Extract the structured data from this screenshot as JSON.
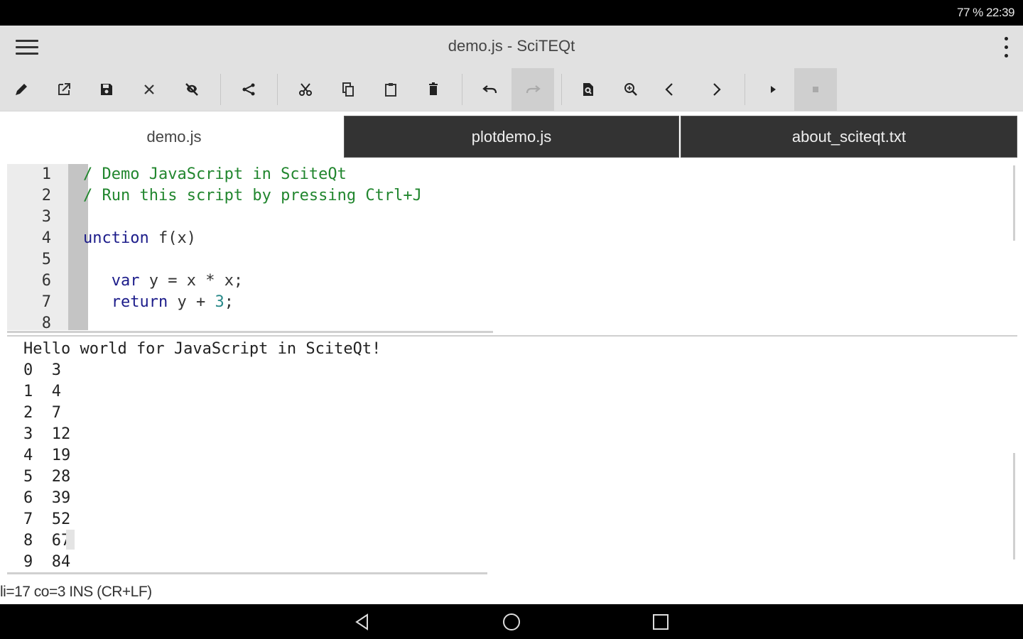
{
  "status_bar": {
    "text": "77 %   22:39"
  },
  "app": {
    "title": "demo.js - SciTEQt"
  },
  "tabs": [
    {
      "label": "demo.js",
      "active": true
    },
    {
      "label": "plotdemo.js",
      "active": false
    },
    {
      "label": "about_sciteqt.txt",
      "active": false
    }
  ],
  "editor": {
    "line_numbers": [
      "1",
      "2",
      "3",
      "4",
      "5",
      "6",
      "7",
      "8"
    ],
    "lines": [
      [
        {
          "t": "/ Demo JavaScript in SciteQt",
          "k": "comment"
        }
      ],
      [
        {
          "t": "/ Run this script by pressing Ctrl+J",
          "k": "comment"
        }
      ],
      [],
      [
        {
          "t": "unction",
          "k": "keyword"
        },
        {
          "t": " f(x)",
          "k": "plain"
        }
      ],
      [],
      [
        {
          "t": "   var",
          "k": "keyword"
        },
        {
          "t": " y = x * x;",
          "k": "plain"
        }
      ],
      [
        {
          "t": "   return",
          "k": "keyword"
        },
        {
          "t": " y + ",
          "k": "plain"
        },
        {
          "t": "3",
          "k": "number"
        },
        {
          "t": ";",
          "k": "plain"
        }
      ],
      []
    ]
  },
  "output": {
    "lines": [
      "Hello world for JavaScript in SciteQt!",
      "0  3",
      "1  4",
      "2  7",
      "3  12",
      "4  19",
      "5  28",
      "6  39",
      "7  52",
      "8  67",
      "9  84"
    ]
  },
  "editor_status": "li=17 co=3 INS (CR+LF)",
  "toolbar": {
    "icons": [
      "edit-icon",
      "open-external-icon",
      "save-icon",
      "close-icon",
      "close-all-icon",
      "share-icon",
      "cut-icon",
      "copy-icon",
      "paste-icon",
      "delete-icon",
      "undo-icon",
      "redo-icon",
      "find-file-icon",
      "find-icon",
      "previous-icon",
      "next-icon",
      "run-icon",
      "stop-icon"
    ]
  },
  "colors": {
    "comment": "#21862e",
    "keyword": "#1c1c8a",
    "number": "#2a8a8a",
    "tab_inactive": "#333333",
    "toolbar": "#e1e1e1"
  }
}
